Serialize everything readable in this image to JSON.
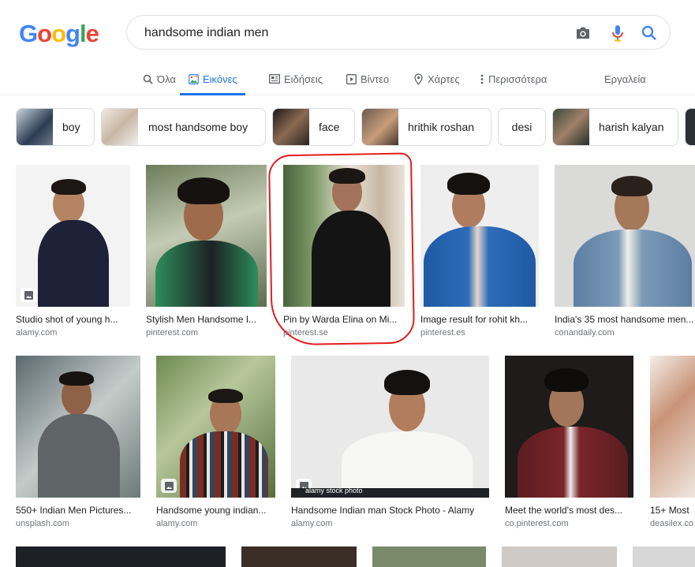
{
  "logo": {
    "letters": [
      "G",
      "o",
      "o",
      "g",
      "l",
      "e"
    ],
    "colors": [
      "#4285f4",
      "#ea4335",
      "#fbbc05",
      "#4285f4",
      "#34a853",
      "#ea4335"
    ]
  },
  "search": {
    "query": "handsome indian men",
    "icons": [
      "camera-icon",
      "microphone-icon",
      "search-icon"
    ]
  },
  "tabs": [
    {
      "label": "Όλα",
      "icon": "search-icon",
      "active": false
    },
    {
      "label": "Εικόνες",
      "icon": "image-icon",
      "active": true
    },
    {
      "label": "Ειδήσεις",
      "icon": "news-icon",
      "active": false
    },
    {
      "label": "Βίντεο",
      "icon": "play-icon",
      "active": false
    },
    {
      "label": "Χάρτες",
      "icon": "map-pin-icon",
      "active": false
    },
    {
      "label": "Περισσότερα",
      "icon": "more-vert-icon",
      "active": false
    }
  ],
  "tools_label": "Εργαλεία",
  "chips": [
    "boy",
    "most handsome boy",
    "face",
    "hrithik roshan",
    "desi",
    "harish kalyan"
  ],
  "results": [
    {
      "caption": "Studio shot of young h...",
      "source": "alamy.com"
    },
    {
      "caption": "Stylish Men Handsome I...",
      "source": "pinterest.com"
    },
    {
      "caption": "Pin by Warda Elina on Mi...",
      "source": "pinterest.se"
    },
    {
      "caption": "Image result for rohit kh...",
      "source": "pinterest.es"
    },
    {
      "caption": "India's 35 most handsome men...",
      "source": "conandaily.com"
    },
    {
      "caption": "550+ Indian Men Pictures...",
      "source": "unsplash.com"
    },
    {
      "caption": "Handsome young indian...",
      "source": "alamy.com"
    },
    {
      "caption": "Handsome Indian man Stock Photo - Alamy",
      "source": "alamy.com"
    },
    {
      "caption": "Meet the world's most des...",
      "source": "co.pinterest.com"
    },
    {
      "caption": "15+ Most",
      "source": "deasilex.co"
    }
  ],
  "watermark_text": "alamy stock photo",
  "colors": {
    "accent": "#1a73e8",
    "highlight_circle": "#e21d1d"
  }
}
